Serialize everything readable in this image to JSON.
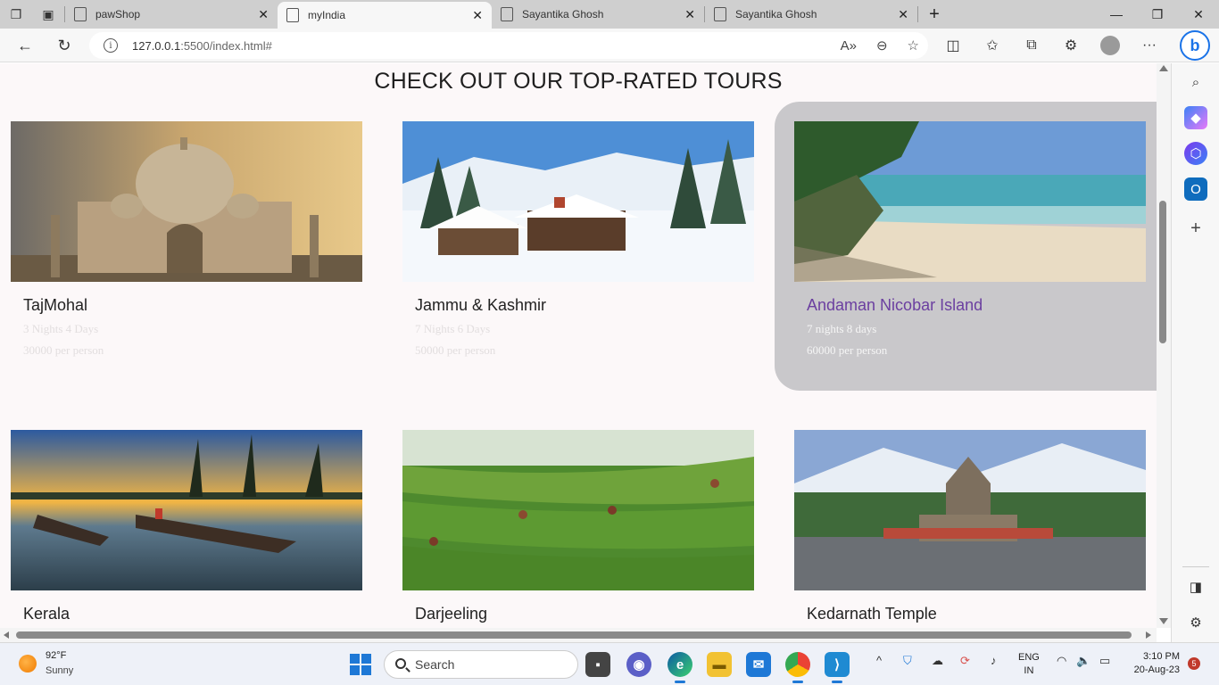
{
  "browser": {
    "tabs": [
      {
        "label": "pawShop",
        "active": false
      },
      {
        "label": "myIndia",
        "active": true
      },
      {
        "label": "Sayantika Ghosh",
        "active": false
      },
      {
        "label": "Sayantika Ghosh",
        "active": false
      }
    ],
    "address": {
      "host": "127.0.0.1",
      "rest": ":5500/index.html#"
    }
  },
  "page": {
    "title": "CHECK OUT OUR TOP-RATED TOURS",
    "tours": [
      {
        "name": "TajMohal",
        "duration": "3 Nights 4 Days",
        "price": "30000 per person"
      },
      {
        "name": "Jammu & Kashmir",
        "duration": "7 Nights 6 Days",
        "price": "50000 per person"
      },
      {
        "name": "Andaman Nicobar Island",
        "duration": "7 nights 8 days",
        "price": "60000 per person"
      },
      {
        "name": "Kerala",
        "duration": "",
        "price": ""
      },
      {
        "name": "Darjeeling",
        "duration": "",
        "price": ""
      },
      {
        "name": "Kedarnath Temple",
        "duration": "",
        "price": ""
      }
    ]
  },
  "taskbar": {
    "weather": {
      "temp": "92°F",
      "desc": "Sunny"
    },
    "search_label": "Search",
    "lang_line1": "ENG",
    "lang_line2": "IN",
    "time": "3:10 PM",
    "date": "20-Aug-23",
    "notification_count": "5"
  },
  "colors": {
    "hover_card_bg": "#c9c8cb",
    "hover_title": "#6b3fa0",
    "page_bg": "#fcf8f9"
  }
}
